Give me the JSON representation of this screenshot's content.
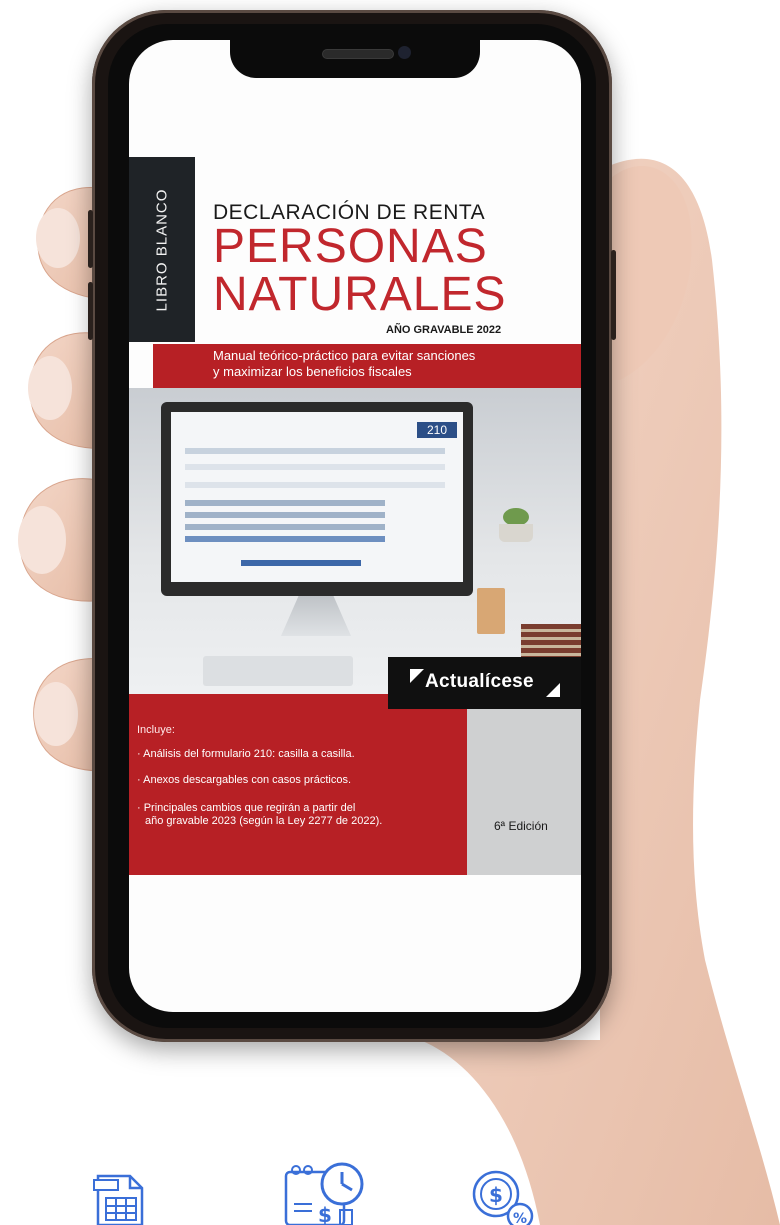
{
  "cover": {
    "spine_label": "LIBRO BLANCO",
    "subtitle_top": "DECLARACIÓN DE RENTA",
    "title_line1": "PERSONAS",
    "title_line2": "NATURALES",
    "year_label": "AÑO GRAVABLE 2022",
    "tagline_line1": "Manual teórico-práctico para evitar sanciones",
    "tagline_line2": "y maximizar los beneficios fiscales",
    "form_number": "210",
    "brand": "Actualícese",
    "includes_label": "Incluye:",
    "bullets": [
      "· Análisis del formulario 210: casilla a casilla.",
      "· Anexos descargables con casos prácticos.",
      "· Principales cambios que regirán a partir del",
      "año gravable 2023 (según la Ley 2277 de 2022)."
    ],
    "edition": "6ª Edición"
  },
  "icons": [
    "spreadsheet-icon",
    "calendar-clock-invoice-icon",
    "money-percent-icon"
  ],
  "colors": {
    "red": "#b72025",
    "dark": "#1f2327",
    "blue_icon": "#3a6fd8"
  }
}
